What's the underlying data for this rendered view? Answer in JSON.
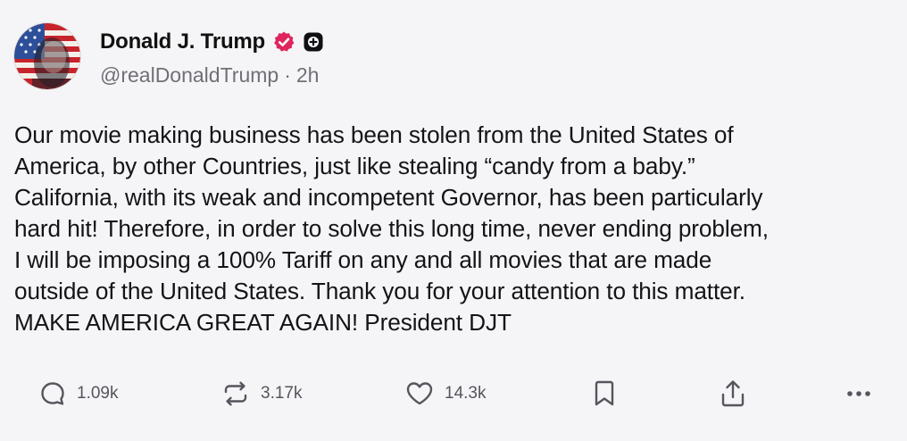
{
  "author": {
    "display_name": "Donald J. Trump",
    "handle": "@realDonaldTrump",
    "separator": "·",
    "time_ago": "2h",
    "avatar_icon": "flag-portrait-avatar",
    "verified_icon": "verified-badge-icon",
    "verified_color": "#e0245e",
    "plus_icon": "plus-badge-icon"
  },
  "post": {
    "text": "Our movie making business has been stolen from the United States of\nAmerica, by other Countries, just like stealing “candy from a baby.”\nCalifornia, with its weak and incompetent Governor, has been particularly\nhard hit! Therefore, in order to solve this long time, never ending problem,\nI will be imposing a 100% Tariff on any and all movies that are made\noutside of the United States. Thank you for your attention to this matter.\nMAKE AMERICA GREAT AGAIN! President DJT"
  },
  "actions": {
    "reply": {
      "icon": "reply-icon",
      "count": "1.09k"
    },
    "repost": {
      "icon": "repost-icon",
      "count": "3.17k"
    },
    "like": {
      "icon": "heart-icon",
      "count": "14.3k"
    },
    "bookmark": {
      "icon": "bookmark-icon"
    },
    "share": {
      "icon": "share-icon"
    },
    "more": {
      "icon": "more-icon"
    }
  },
  "colors": {
    "background": "#f5f5f7",
    "text": "#141418",
    "muted": "#6f6f78",
    "icon": "#55555d"
  }
}
